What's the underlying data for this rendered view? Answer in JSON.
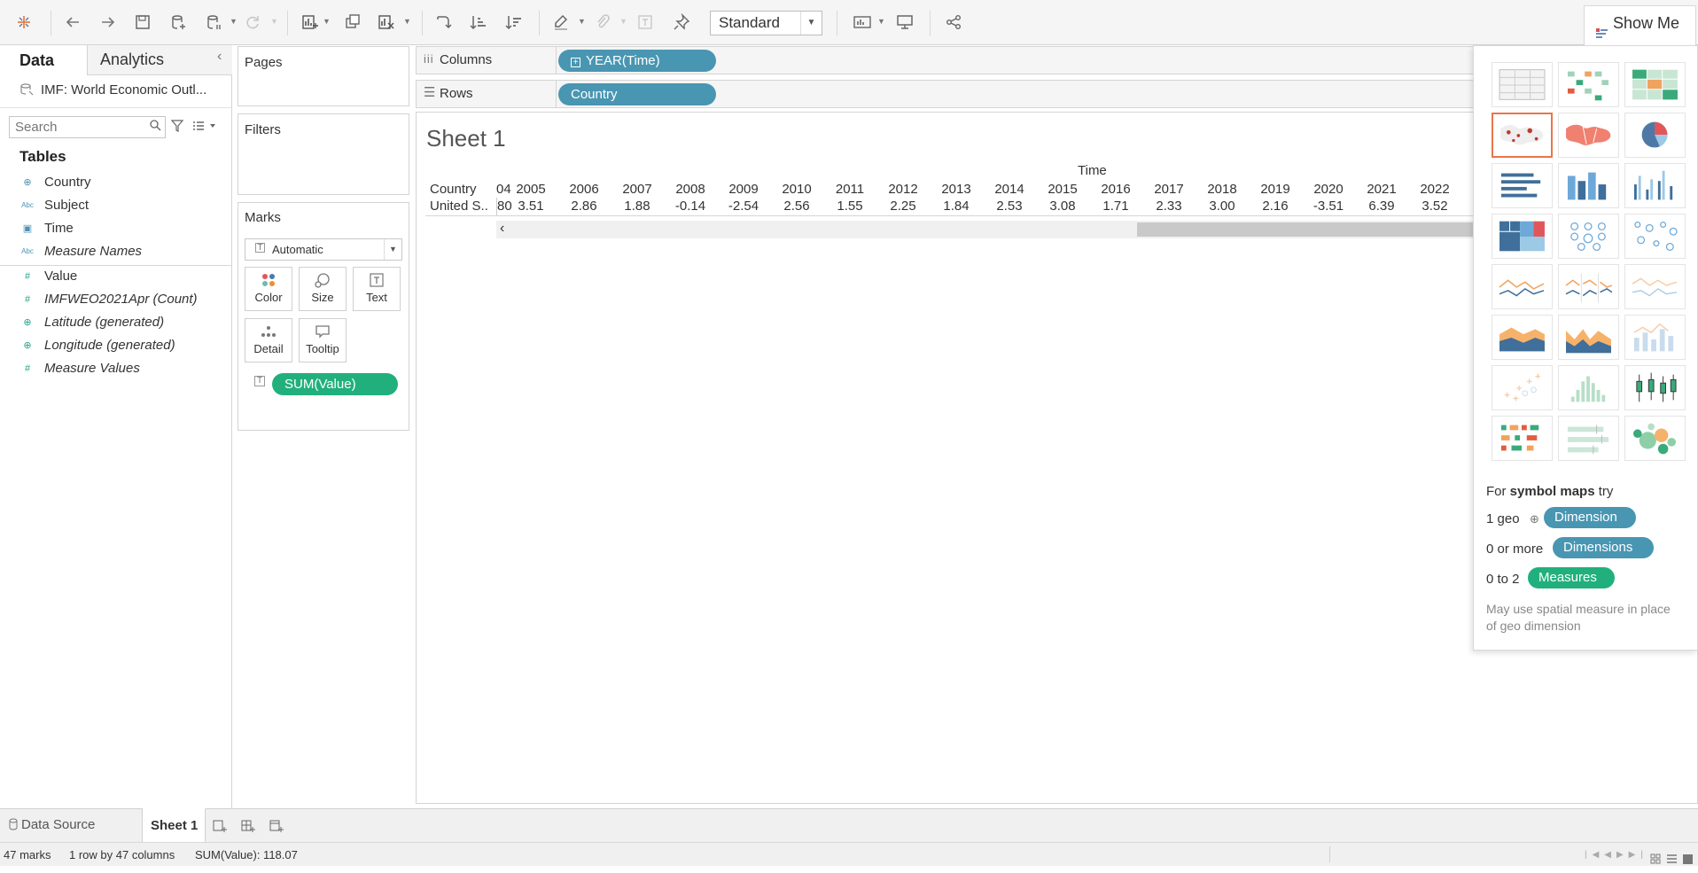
{
  "toolbar": {
    "fit_select": "Standard",
    "show_me_label": "Show Me",
    "icons": [
      "tableau-logo-icon",
      "undo-icon",
      "redo-icon",
      "save-icon",
      "new-datasource-icon",
      "pause-updates-icon",
      "refresh-icon",
      "new-worksheet-icon",
      "duplicate-icon",
      "clear-sheet-icon",
      "swap-icon",
      "sort-ascending-icon",
      "sort-descending-icon",
      "highlight-icon",
      "group-icon",
      "labels-icon",
      "pin-icon",
      "show-cards-icon",
      "presentation-icon",
      "share-icon"
    ]
  },
  "data_pane": {
    "tab_data": "Data",
    "tab_analytics": "Analytics",
    "datasource": "IMF: World Economic Outl...",
    "search_placeholder": "Search",
    "tables_heading": "Tables",
    "fields": [
      {
        "type_icon": "⊕",
        "label": "Country",
        "kind": "dimension"
      },
      {
        "type_icon": "Abc",
        "label": "Subject",
        "kind": "dimension"
      },
      {
        "type_icon": "▣",
        "label": "Time",
        "kind": "dimension"
      },
      {
        "type_icon": "Abc",
        "label": "Measure Names",
        "kind": "dimension"
      },
      {
        "type_icon": "#",
        "label": "Value",
        "kind": "measure"
      },
      {
        "type_icon": "#",
        "label": "IMFWEO2021Apr (Count)",
        "kind": "measure"
      },
      {
        "type_icon": "⊕",
        "label": "Latitude (generated)",
        "kind": "measure"
      },
      {
        "type_icon": "⊕",
        "label": "Longitude (generated)",
        "kind": "measure"
      },
      {
        "type_icon": "#",
        "label": "Measure Values",
        "kind": "measure"
      }
    ]
  },
  "shelves": {
    "pages": "Pages",
    "filters": "Filters",
    "marks": "Marks",
    "mark_type": "Automatic",
    "mark_buttons": [
      "Color",
      "Size",
      "Text",
      "Detail",
      "Tooltip"
    ],
    "marks_pill": "SUM(Value)",
    "columns_label": "Columns",
    "columns_pill": "YEAR(Time)",
    "rows_label": "Rows",
    "rows_pill": "Country"
  },
  "view": {
    "sheet_title": "Sheet 1",
    "header_time": "Time",
    "header_country": "Country",
    "row_label": "United S..",
    "first_col_partial": "04",
    "first_val_partial": "80",
    "years": [
      "2005",
      "2006",
      "2007",
      "2008",
      "2009",
      "2010",
      "2011",
      "2012",
      "2013",
      "2014",
      "2015",
      "2016",
      "2017",
      "2018",
      "2019",
      "2020",
      "2021",
      "2022"
    ],
    "values": [
      "3.51",
      "2.86",
      "1.88",
      "-0.14",
      "-2.54",
      "2.56",
      "1.55",
      "2.25",
      "1.84",
      "2.53",
      "3.08",
      "1.71",
      "2.33",
      "3.00",
      "2.16",
      "-3.51",
      "6.39",
      "3.52"
    ],
    "scroll_left": "‹"
  },
  "show_me": {
    "hint_prefix": "For ",
    "hint_bold": "symbol maps",
    "hint_suffix": " try",
    "rows": [
      {
        "prefix": "1 geo",
        "pill": "Dimension",
        "color": "#4996b2"
      },
      {
        "prefix": "0 or more",
        "pill": "Dimensions",
        "color": "#4996b2"
      },
      {
        "prefix": "0 to 2",
        "pill": "Measures",
        "color": "#21b07d"
      }
    ],
    "note": "May use spatial measure in place of geo dimension"
  },
  "tabs": {
    "data_source": "Data Source",
    "sheet": "Sheet 1"
  },
  "status": {
    "marks": "47 marks",
    "dims": "1 row by 47 columns",
    "sum": "SUM(Value): 118.07"
  }
}
